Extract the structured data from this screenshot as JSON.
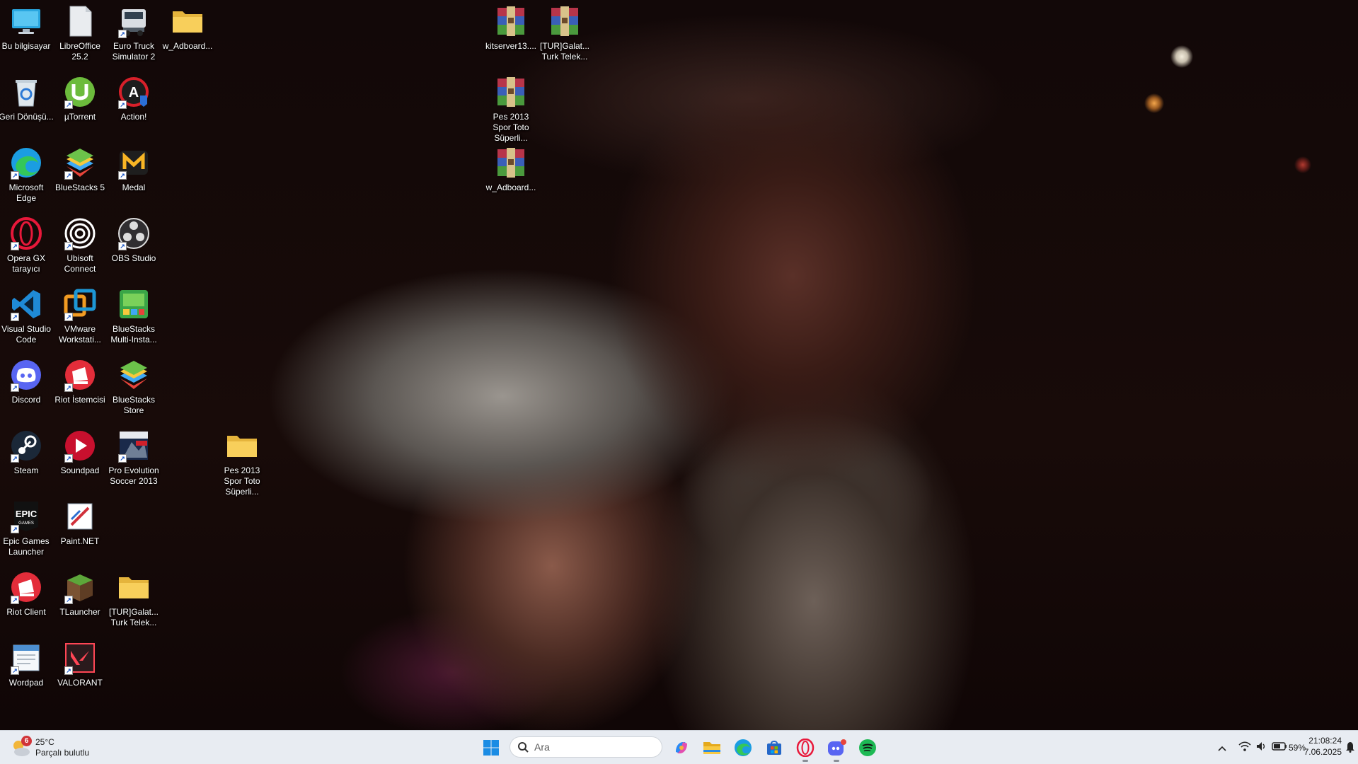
{
  "desktop": {
    "icons": [
      {
        "label": "Bu bilgisayar",
        "icon": "this-pc-icon"
      },
      {
        "label": "LibreOffice 25.2",
        "icon": "libreoffice-icon"
      },
      {
        "label": "Euro Truck Simulator 2",
        "icon": "euro-truck-icon"
      },
      {
        "label": "w_Adboard...",
        "icon": "folder-icon"
      },
      {
        "label": "Geri Dönüşü...",
        "icon": "recycle-bin-icon"
      },
      {
        "label": "µTorrent",
        "icon": "utorrent-icon"
      },
      {
        "label": "Action!",
        "icon": "action-icon"
      },
      {
        "label": "Microsoft Edge",
        "icon": "edge-icon"
      },
      {
        "label": "BlueStacks 5",
        "icon": "bluestacks-icon"
      },
      {
        "label": "Medal",
        "icon": "medal-icon"
      },
      {
        "label": "Opera GX tarayıcı",
        "icon": "opera-gx-icon"
      },
      {
        "label": "Ubisoft Connect",
        "icon": "ubisoft-icon"
      },
      {
        "label": "OBS Studio",
        "icon": "obs-icon"
      },
      {
        "label": "Visual Studio Code",
        "icon": "vscode-icon"
      },
      {
        "label": "VMware Workstati...",
        "icon": "vmware-icon"
      },
      {
        "label": "BlueStacks Multi-Insta...",
        "icon": "bluestacks-multi-icon"
      },
      {
        "label": "Discord",
        "icon": "discord-icon"
      },
      {
        "label": "Riot İstemcisi",
        "icon": "riot-icon"
      },
      {
        "label": "BlueStacks Store",
        "icon": "bluestacks-store-icon"
      },
      {
        "label": "Steam",
        "icon": "steam-icon"
      },
      {
        "label": "Soundpad",
        "icon": "soundpad-icon"
      },
      {
        "label": "Pro Evolution Soccer 2013",
        "icon": "pes-icon"
      },
      {
        "label": "Pes 2013 Spor Toto Süperli...",
        "icon": "folder-icon"
      },
      {
        "label": "Epic Games Launcher",
        "icon": "epic-games-icon"
      },
      {
        "label": "Paint.NET",
        "icon": "paintnet-icon"
      },
      {
        "label": "Riot Client",
        "icon": "riot-client-icon"
      },
      {
        "label": "TLauncher",
        "icon": "tlauncher-icon"
      },
      {
        "label": "[TUR]Galat... Turk Telek...",
        "icon": "folder-icon"
      },
      {
        "label": "Wordpad",
        "icon": "wordpad-icon"
      },
      {
        "label": "VALORANT",
        "icon": "valorant-icon"
      },
      {
        "label": "kitserver13....",
        "icon": "winrar-icon"
      },
      {
        "label": "[TUR]Galat... Turk Telek...",
        "icon": "winrar-icon"
      },
      {
        "label": "Pes 2013 Spor Toto Süperli...",
        "icon": "winrar-icon"
      },
      {
        "label": "w_Adboard...",
        "icon": "winrar-icon"
      }
    ]
  },
  "taskbar": {
    "weather": {
      "temp": "25°C",
      "desc": "Parçalı bulutlu",
      "badge": "6"
    },
    "search_placeholder": "Ara",
    "apps": [
      "windows-start-icon",
      "copilot-icon",
      "file-explorer-icon",
      "edge-icon",
      "microsoft-store-icon",
      "opera-gx-icon",
      "discord-icon",
      "spotify-icon"
    ],
    "tray": {
      "battery": "59%",
      "time": "21:08:24",
      "date": "7.06.2025"
    }
  }
}
